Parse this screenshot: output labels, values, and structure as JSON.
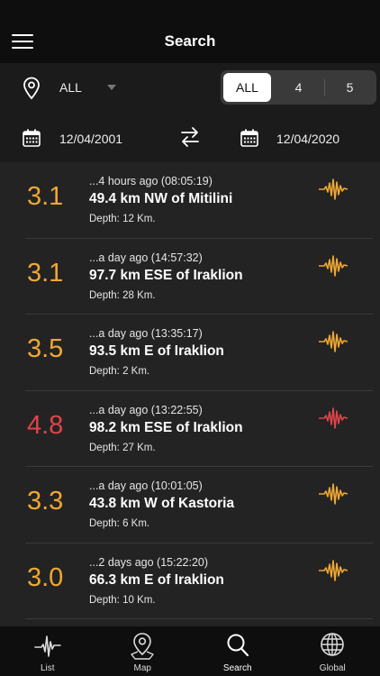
{
  "header": {
    "title": "Search",
    "menu_icon": "hamburger-menu-icon"
  },
  "filters": {
    "location_icon": "location-pin-icon",
    "region_selected": "ALL",
    "magnitude_options": [
      "ALL",
      "4",
      "5"
    ],
    "magnitude_selected": "ALL",
    "date_from": "12/04/2001",
    "date_to": "12/04/2020",
    "calendar_icon": "calendar-icon",
    "swap_icon": "swap-arrows-icon"
  },
  "colors": {
    "moderate": "#f0a733",
    "strong": "#e0434a"
  },
  "earthquakes": [
    {
      "magnitude": "3.1",
      "time": "...4 hours ago (08:05:19)",
      "place": "49.4 km NW of Mitilini",
      "depth": "Depth: 12 Km.",
      "level": "moderate"
    },
    {
      "magnitude": "3.1",
      "time": "...a day ago (14:57:32)",
      "place": "97.7 km ESE of Iraklion",
      "depth": "Depth: 28 Km.",
      "level": "moderate"
    },
    {
      "magnitude": "3.5",
      "time": "...a day ago (13:35:17)",
      "place": "93.5 km E of Iraklion",
      "depth": "Depth: 2 Km.",
      "level": "moderate"
    },
    {
      "magnitude": "4.8",
      "time": "...a day ago (13:22:55)",
      "place": "98.2 km ESE of Iraklion",
      "depth": "Depth: 27 Km.",
      "level": "strong"
    },
    {
      "magnitude": "3.3",
      "time": "...a day ago (10:01:05)",
      "place": "43.8 km W of Kastoria",
      "depth": "Depth: 6 Km.",
      "level": "moderate"
    },
    {
      "magnitude": "3.0",
      "time": "...2 days ago (15:22:20)",
      "place": "66.3 km E of Iraklion",
      "depth": "Depth: 10 Km.",
      "level": "moderate"
    }
  ],
  "tabs": [
    {
      "label": "List",
      "icon": "seismograph-icon"
    },
    {
      "label": "Map",
      "icon": "map-pin-icon"
    },
    {
      "label": "Search",
      "icon": "search-icon",
      "active": true
    },
    {
      "label": "Global",
      "icon": "globe-icon"
    }
  ]
}
